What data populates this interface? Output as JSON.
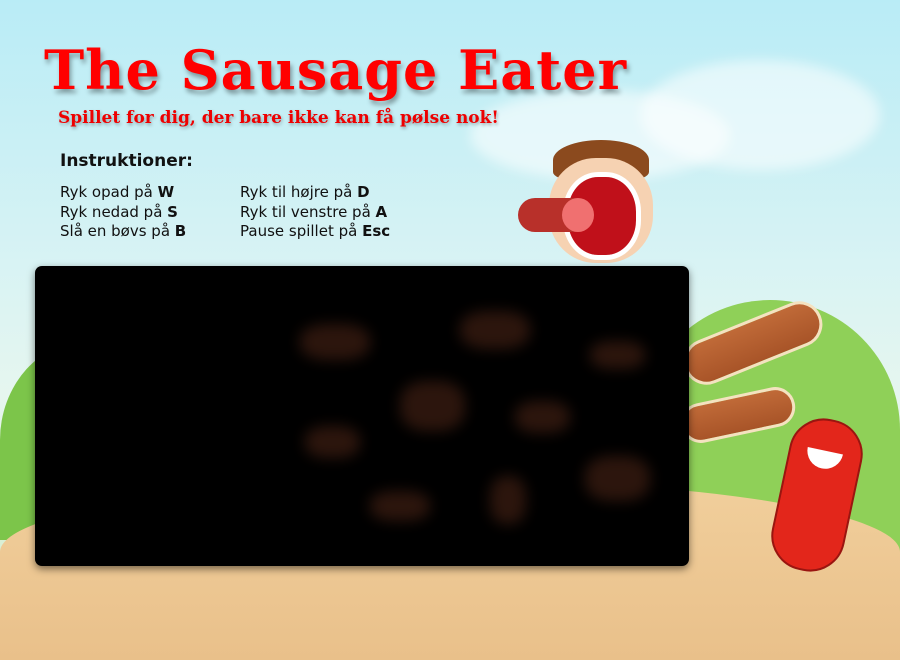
{
  "header": {
    "title": "The Sausage Eater",
    "subtitle": "Spillet for dig, der bare ikke kan få pølse nok!"
  },
  "instructions": {
    "heading": "Instruktioner:",
    "left": [
      {
        "text": "Ryk opad på ",
        "key": "W"
      },
      {
        "text": "Ryk nedad på ",
        "key": "S"
      },
      {
        "text": "Slå en bøvs på ",
        "key": "B"
      }
    ],
    "right": [
      {
        "text": "Ryk til højre på ",
        "key": "D"
      },
      {
        "text": "Ryk til venstre på ",
        "key": "A"
      },
      {
        "text": "Pause spillet på ",
        "key": "Esc"
      }
    ]
  },
  "colors": {
    "title": "#ff0000",
    "canvas": "#000000"
  }
}
